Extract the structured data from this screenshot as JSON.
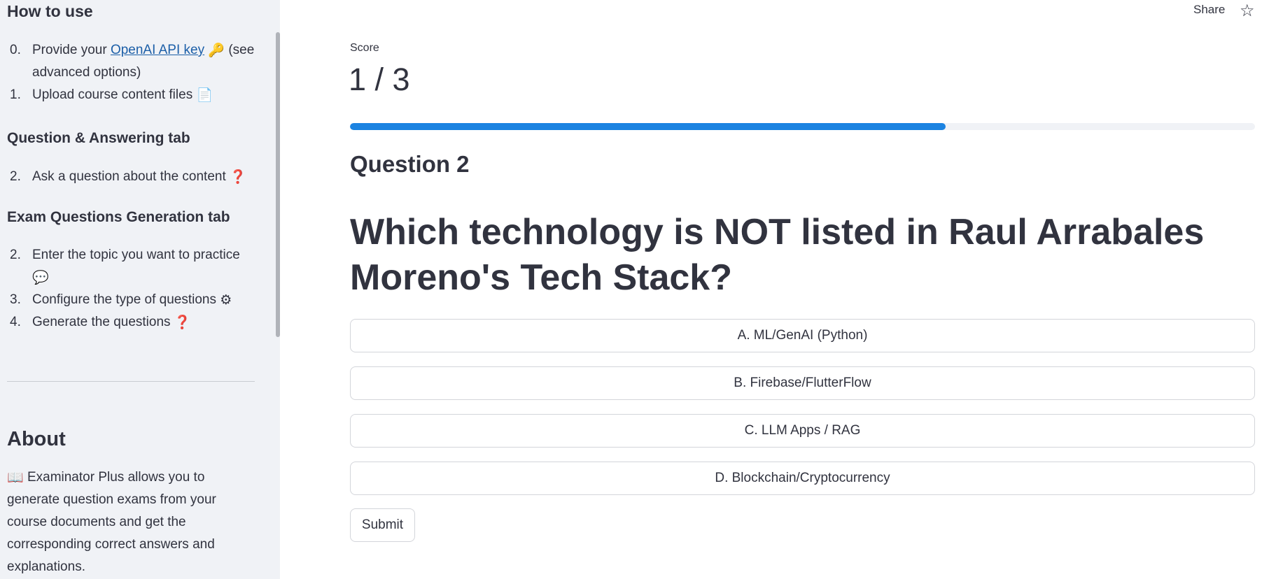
{
  "sidebar": {
    "how_to_use_title": "How to use",
    "setup_items": [
      {
        "num": "0.",
        "text_before": "Provide your ",
        "link": "OpenAI API key",
        "emoji": "🔑",
        "text_after": " (see advanced options)"
      },
      {
        "num": "1.",
        "text": "Upload course content files",
        "emoji": "📄"
      }
    ],
    "qa_tab_title": "Question & Answering tab",
    "qa_items": [
      {
        "num": "2.",
        "text": "Ask a question about the content",
        "emoji": "❓"
      }
    ],
    "exam_tab_title": "Exam Questions Generation tab",
    "exam_items": [
      {
        "num": "2.",
        "text": "Enter the topic you want to practice",
        "emoji": "💬"
      },
      {
        "num": "3.",
        "text": "Configure the type of questions",
        "emoji": "⚙"
      },
      {
        "num": "4.",
        "text": "Generate the questions",
        "emoji": "❓"
      }
    ],
    "about_title": "About",
    "about_emoji": "📖",
    "about_text": "Examinator Plus allows you to generate question exams from your course documents and get the corresponding correct answers and explanations."
  },
  "header": {
    "share_label": "Share",
    "star_icon": "star-icon"
  },
  "main": {
    "score_label": "Score",
    "score_value": "1 / 3",
    "progress_fraction": 0.658,
    "question_number": "Question 2",
    "question_text": "Which technology is NOT listed in Raul Arrabales Moreno's Tech Stack?",
    "options": [
      "A. ML/GenAI (Python)",
      "B. Firebase/FlutterFlow",
      "C. LLM Apps / RAG",
      "D. Blockchain/Cryptocurrency"
    ],
    "submit_label": "Submit"
  },
  "colors": {
    "sidebar_bg": "#f0f2f6",
    "progress_fill": "#1c83e1",
    "link": "#1c5fa8",
    "text": "#31333f"
  }
}
